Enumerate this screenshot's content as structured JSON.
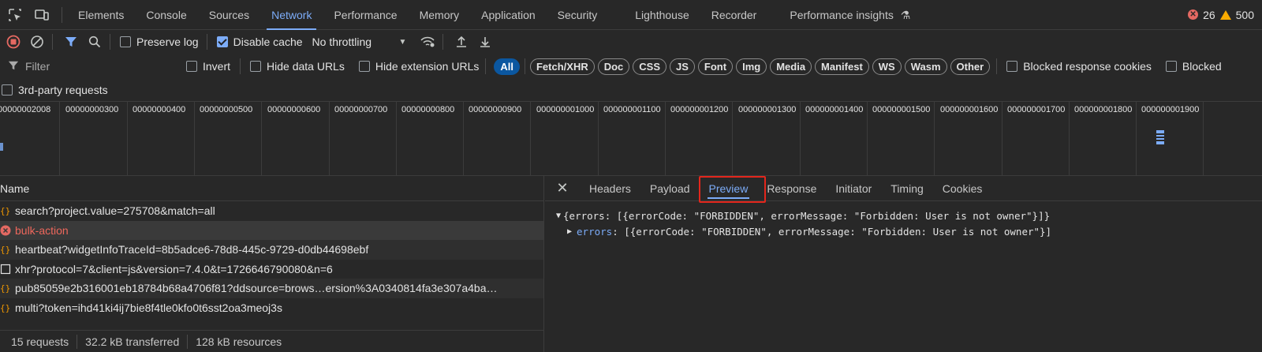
{
  "panel_tabs": [
    "Elements",
    "Console",
    "Sources",
    "Network",
    "Performance",
    "Memory",
    "Application",
    "Security",
    "Lighthouse",
    "Recorder",
    "Performance insights"
  ],
  "active_panel": "Network",
  "counts": {
    "errors": "26",
    "warnings": "500"
  },
  "toolbar": {
    "preserve_log": "Preserve log",
    "disable_cache": "Disable cache",
    "throttling": "No throttling"
  },
  "filterbar": {
    "filter_placeholder": "Filter",
    "invert": "Invert",
    "hide_data_urls": "Hide data URLs",
    "hide_extension_urls": "Hide extension URLs",
    "types": [
      "All",
      "Fetch/XHR",
      "Doc",
      "CSS",
      "JS",
      "Font",
      "Img",
      "Media",
      "Manifest",
      "WS",
      "Wasm",
      "Other"
    ],
    "active_type": "All",
    "blocked_response_cookies": "Blocked response cookies",
    "blocked": "Blocked"
  },
  "third_party": "3rd-party requests",
  "overview": {
    "tick_labels": [
      "00000002008",
      "00000000300",
      "00000000400",
      "00000000500",
      "00000000600",
      "00000000700",
      "00000000800",
      "00000000900",
      "000000001000",
      "000000001100",
      "000000001200",
      "000000001300",
      "000000001400",
      "000000001500",
      "000000001600",
      "000000001700",
      "000000001800",
      "000000001900"
    ]
  },
  "requests": {
    "header": "Name",
    "items": [
      {
        "name": "search?project.value=275708&match=all",
        "kind": "xhr"
      },
      {
        "name": "bulk-action",
        "kind": "error"
      },
      {
        "name": "heartbeat?widgetInfoTraceId=8b5adce6-78d8-445c-9729-d0db44698ebf",
        "kind": "xhr"
      },
      {
        "name": "xhr?protocol=7&client=js&version=7.4.0&t=1726646790080&n=6",
        "kind": "doc"
      },
      {
        "name": "pub85059e2b316001eb18784b68a4706f81?ddsource=brows…ersion%3A0340814fa3e307a4ba…",
        "kind": "xhr"
      },
      {
        "name": "multi?token=ihd41ki4ij7bie8f4tle0kfo0t6sst2oa3meoj3s",
        "kind": "xhr"
      }
    ]
  },
  "status_bar": {
    "requests": "15 requests",
    "transferred": "32.2 kB transferred",
    "resources": "128 kB resources"
  },
  "detail_tabs": [
    "Headers",
    "Payload",
    "Preview",
    "Response",
    "Initiator",
    "Timing",
    "Cookies"
  ],
  "active_detail_tab": "Preview",
  "preview": {
    "summary": "{errors: [{errorCode: \"FORBIDDEN\", errorMessage: \"Forbidden: User is not owner\"}]}",
    "key": "errors",
    "value": ": [{errorCode: \"FORBIDDEN\", errorMessage: \"Forbidden: User is not owner\"}]"
  },
  "colors": {
    "accent": "#7cacf8",
    "error": "#e46962",
    "warning": "#f9ab00",
    "highlight": "#e3261c"
  }
}
